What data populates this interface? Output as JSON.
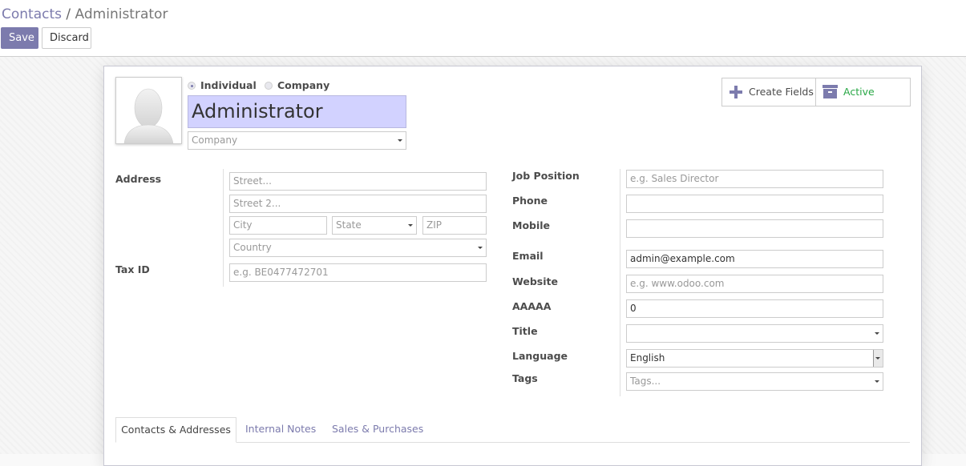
{
  "breadcrumb": {
    "parent": "Contacts",
    "separator": "/",
    "current": "Administrator"
  },
  "toolbar": {
    "save_label": "Save",
    "discard_label": "Discard"
  },
  "form": {
    "type_options": {
      "individual": "Individual",
      "company": "Company",
      "selected": "Individual"
    },
    "name": "Administrator",
    "company_placeholder": "Company",
    "address_label": "Address",
    "street_placeholder": "Street...",
    "street2_placeholder": "Street 2...",
    "city_placeholder": "City",
    "state_placeholder": "State",
    "zip_placeholder": "ZIP",
    "country_placeholder": "Country",
    "tax_id_label": "Tax ID",
    "tax_id_placeholder": "e.g. BE0477472701",
    "job_position_label": "Job Position",
    "job_position_placeholder": "e.g. Sales Director",
    "phone_label": "Phone",
    "mobile_label": "Mobile",
    "email_label": "Email",
    "email_value": "admin@example.com",
    "website_label": "Website",
    "website_placeholder": "e.g. www.odoo.com",
    "aaaaa_label": "AAAAA",
    "aaaaa_value": "0",
    "title_label": "Title",
    "language_label": "Language",
    "language_value": "English",
    "tags_label": "Tags",
    "tags_placeholder": "Tags..."
  },
  "button_box": {
    "create_fields": "Create Fields",
    "active": "Active"
  },
  "tabs": [
    "Contacts & Addresses",
    "Internal Notes",
    "Sales & Purchases"
  ],
  "colors": {
    "accent": "#7c7bad",
    "active_green": "#28a745",
    "name_highlight": "#d2d2ff"
  }
}
